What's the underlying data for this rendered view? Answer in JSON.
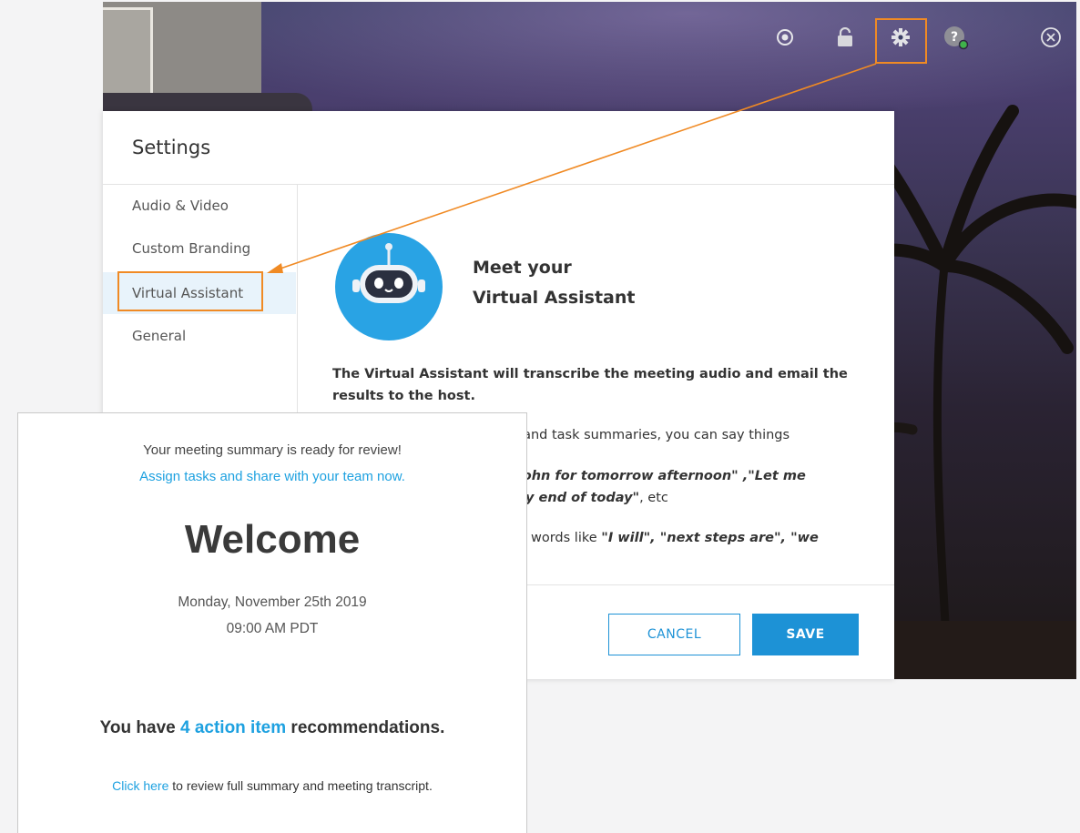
{
  "colors": {
    "accent": "#1d92d6",
    "highlight": "#f08a24",
    "link": "#1ea1e0"
  },
  "toolbar": {
    "icons": [
      "record-icon",
      "unlock-icon",
      "gear-icon",
      "help-icon",
      "close-icon"
    ]
  },
  "settings": {
    "title": "Settings",
    "nav": [
      {
        "label": "Audio & Video"
      },
      {
        "label": "Custom Branding"
      },
      {
        "label": "Virtual Assistant",
        "active": true
      },
      {
        "label": "General"
      }
    ],
    "content": {
      "heading_line1": "Meet your",
      "heading_line2": "Virtual Assistant",
      "desc_line1": "The Virtual Assistant will transcribe the meeting audio and email the",
      "desc_line2": "results to the host.",
      "p2_line1": "es and task summaries, you can say things",
      "p3_line1": "h John for tomorrow afternoon\" ,\"Let me",
      "p3_line2_quote": "s by end of today\"",
      "p3_line2_rest": ", etc",
      "p4_line1_pre": "words like ",
      "p4_line1_quote": "\"I will\", \"next steps are\", \"we"
    },
    "buttons": {
      "cancel": "CANCEL",
      "save": "SAVE"
    }
  },
  "email": {
    "ready": "Your meeting summary is ready for review!",
    "assign_link": "Assign tasks and share with your team now.",
    "welcome": "Welcome",
    "date": "Monday, November 25th 2019",
    "time": "09:00 AM PDT",
    "action_pre": "You have ",
    "action_highlight": "4 action item",
    "action_post": " recommendations.",
    "click_link": "Click here",
    "click_rest": " to review full summary and meeting transcript."
  }
}
